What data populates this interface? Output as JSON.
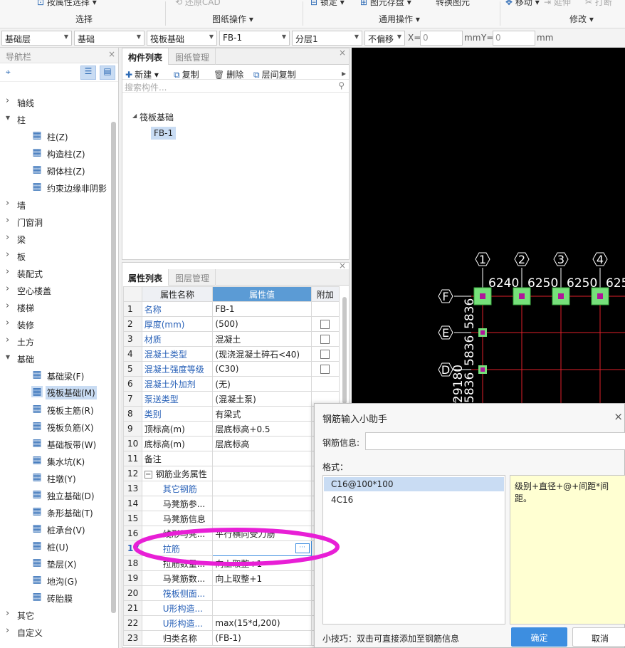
{
  "ribbon": {
    "select_button": "按属性选择",
    "restore_cad": "还原CAD",
    "lock": "锁定",
    "save_element": "图元存盘",
    "convert_element": "转换图元",
    "move": "移动",
    "extend": "延伸",
    "break": "打断",
    "group_select": "选择",
    "group_drawing": "图纸操作",
    "group_common": "通用操作",
    "group_modify": "修改"
  },
  "toolbar": {
    "layer": "基础层",
    "category": "基础",
    "type": "筏板基础",
    "component": "FB-1",
    "floor": "分层1",
    "offset": "不偏移",
    "x_label": "X=",
    "x_value": "0",
    "mm_label": "mm",
    "y_label": "Y=",
    "y_value": "0",
    "mm_label2": "mm"
  },
  "nav": {
    "title": "导航栏",
    "close": "×",
    "items": [
      {
        "label": "轴线",
        "expanded": false
      },
      {
        "label": "柱",
        "expanded": true
      },
      {
        "label": "柱(Z)",
        "sub": true,
        "icon": "column-icon"
      },
      {
        "label": "构造柱(Z)",
        "sub": true,
        "icon": "construct-column-icon"
      },
      {
        "label": "砌体柱(Z)",
        "sub": true,
        "icon": "masonry-column-icon"
      },
      {
        "label": "约束边缘非阴影",
        "sub": true,
        "icon": "edge-icon"
      },
      {
        "label": "墙",
        "expanded": false
      },
      {
        "label": "门窗洞",
        "expanded": false
      },
      {
        "label": "梁",
        "expanded": false
      },
      {
        "label": "板",
        "expanded": false
      },
      {
        "label": "装配式",
        "expanded": false
      },
      {
        "label": "空心楼盖",
        "expanded": false
      },
      {
        "label": "楼梯",
        "expanded": false
      },
      {
        "label": "装修",
        "expanded": false
      },
      {
        "label": "土方",
        "expanded": false
      },
      {
        "label": "基础",
        "expanded": true
      },
      {
        "label": "基础梁(F)",
        "sub": true,
        "icon": "foundation-beam-icon"
      },
      {
        "label": "筏板基础(M)",
        "sub": true,
        "icon": "raft-foundation-icon",
        "selected": true
      },
      {
        "label": "筏板主筋(R)",
        "sub": true,
        "icon": "raft-main-rebar-icon"
      },
      {
        "label": "筏板负筋(X)",
        "sub": true,
        "icon": "raft-neg-rebar-icon"
      },
      {
        "label": "基础板带(W)",
        "sub": true,
        "icon": "slab-band-icon"
      },
      {
        "label": "集水坑(K)",
        "sub": true,
        "icon": "sump-icon"
      },
      {
        "label": "柱墩(Y)",
        "sub": true,
        "icon": "column-pier-icon"
      },
      {
        "label": "独立基础(D)",
        "sub": true,
        "icon": "isolated-footing-icon"
      },
      {
        "label": "条形基础(T)",
        "sub": true,
        "icon": "strip-footing-icon"
      },
      {
        "label": "桩承台(V)",
        "sub": true,
        "icon": "pile-cap-icon"
      },
      {
        "label": "桩(U)",
        "sub": true,
        "icon": "pile-icon"
      },
      {
        "label": "垫层(X)",
        "sub": true,
        "icon": "cushion-icon"
      },
      {
        "label": "地沟(G)",
        "sub": true,
        "icon": "trench-icon"
      },
      {
        "label": "砖胎膜",
        "sub": true,
        "icon": "brick-mold-icon"
      },
      {
        "label": "其它",
        "expanded": false
      },
      {
        "label": "自定义",
        "expanded": false
      }
    ]
  },
  "component_list": {
    "tab_active": "构件列表",
    "tab_inactive": "图纸管理",
    "new": "新建",
    "copy": "复制",
    "delete": "删除",
    "floor_copy": "层间复制",
    "search_placeholder": "搜索构件...",
    "tree_root": "筏板基础",
    "tree_child": "FB-1"
  },
  "properties": {
    "tab_active": "属性列表",
    "tab_inactive": "图层管理",
    "col_name": "属性名称",
    "col_value": "属性值",
    "col_extra": "附加",
    "rows": [
      {
        "n": "1",
        "k": "名称",
        "v": "FB-1",
        "blue": true,
        "chk": false
      },
      {
        "n": "2",
        "k": "厚度(mm)",
        "v": "(500)",
        "blue": true,
        "chk": true
      },
      {
        "n": "3",
        "k": "材质",
        "v": "混凝土",
        "blue": true,
        "chk": true
      },
      {
        "n": "4",
        "k": "混凝土类型",
        "v": "(现浇混凝土碎石<40)",
        "blue": true,
        "chk": true
      },
      {
        "n": "5",
        "k": "混凝土强度等级",
        "v": "(C30)",
        "blue": true,
        "chk": true
      },
      {
        "n": "6",
        "k": "混凝土外加剂",
        "v": "(无)",
        "blue": true,
        "chk": false
      },
      {
        "n": "7",
        "k": "泵送类型",
        "v": "(混凝土泵)",
        "blue": true,
        "chk": false
      },
      {
        "n": "8",
        "k": "类别",
        "v": "有梁式",
        "blue": true,
        "chk": false
      },
      {
        "n": "9",
        "k": "顶标高(m)",
        "v": "层底标高+0.5",
        "blue": false,
        "chk": false
      },
      {
        "n": "10",
        "k": "底标高(m)",
        "v": "层底标高",
        "blue": false,
        "chk": false
      },
      {
        "n": "11",
        "k": "备注",
        "v": "",
        "blue": false,
        "chk": false
      },
      {
        "n": "12",
        "k": "钢筋业务属性",
        "v": "",
        "blue": false,
        "chk": false,
        "group": true
      },
      {
        "n": "13",
        "k": "其它钢筋",
        "v": "",
        "blue": true,
        "chk": false,
        "indent": true
      },
      {
        "n": "14",
        "k": "马凳筋参...",
        "v": "",
        "blue": false,
        "chk": false,
        "indent": true
      },
      {
        "n": "15",
        "k": "马凳筋信息",
        "v": "",
        "blue": false,
        "chk": false,
        "indent": true
      },
      {
        "n": "16",
        "k": "线形马凳...",
        "v": "平行横向受力筋",
        "blue": false,
        "chk": false,
        "indent": true
      },
      {
        "n": "17",
        "k": "拉筋",
        "v": "",
        "blue": true,
        "chk": false,
        "indent": true,
        "selected": true
      },
      {
        "n": "18",
        "k": "拉筋数量...",
        "v": "向上取整+1",
        "blue": false,
        "chk": false,
        "indent": true
      },
      {
        "n": "19",
        "k": "马凳筋数...",
        "v": "向上取整+1",
        "blue": false,
        "chk": false,
        "indent": true
      },
      {
        "n": "20",
        "k": "筏板侧面...",
        "v": "",
        "blue": true,
        "chk": false,
        "indent": true
      },
      {
        "n": "21",
        "k": "U形构造...",
        "v": "",
        "blue": true,
        "chk": false,
        "indent": true
      },
      {
        "n": "22",
        "k": "U形构造...",
        "v": "max(15*d,200)",
        "blue": true,
        "chk": false,
        "indent": true
      },
      {
        "n": "23",
        "k": "归类名称",
        "v": "(FB-1)",
        "blue": false,
        "chk": false,
        "indent": true
      }
    ]
  },
  "canvas": {
    "axis_numbers": [
      "1",
      "2",
      "3",
      "4"
    ],
    "axis_letters": [
      "F",
      "E",
      "D"
    ],
    "top_dims": [
      "6240",
      "6250",
      "6250",
      "625"
    ],
    "side_dims": [
      "5836",
      "5836",
      "5836",
      "29180"
    ],
    "colors": {
      "grid": "#e0202a",
      "pad": "#76e07a",
      "bg": "#000000",
      "text": "#ffffff"
    }
  },
  "dialog": {
    "title": "钢筋输入小助手",
    "close": "×",
    "info_label": "钢筋信息:",
    "info_value": "",
    "format_label": "格式：",
    "options": [
      "C16@100*100",
      "4C16"
    ],
    "description": "级别+直径+@+间距*间距。",
    "tip": "小技巧：双击可直接添加至钢筋信息",
    "ok": "确定",
    "cancel": "取消"
  },
  "highlight_color": "#e81fd6"
}
